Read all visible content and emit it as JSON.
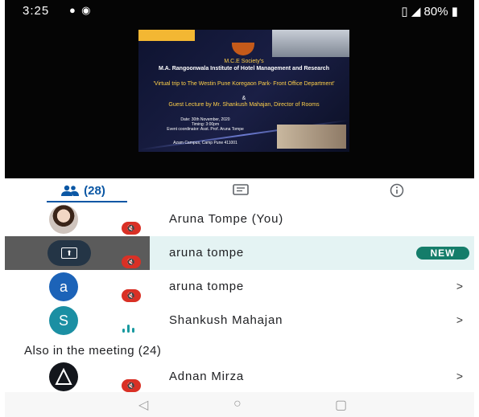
{
  "status_bar": {
    "time": "3:25",
    "battery": "80%"
  },
  "poster": {
    "society": "M.C.E Society's",
    "institute": "M.A. Rangoonwala Institute of Hotel Management and Research",
    "event": "'Virtual trip to The Westin Pune Koregaon Park- Front Office Department'",
    "amp": "&",
    "lecture": "Guest Lecture by Mr. Shankush Mahajan, Director of Rooms",
    "date": "Date: 30th November, 2020",
    "timing": "Timing: 3:00pm",
    "coordinator": "Event coordinator: Asst. Prof. Aruna Tompe",
    "footer": "Azam Campus, Camp Pune 411001"
  },
  "tabs": {
    "people_count": "(28)"
  },
  "participants": [
    {
      "name": "Aruna Tompe (You)"
    },
    {
      "name": "aruna tompe",
      "badge": "NEW"
    },
    {
      "name": "aruna tompe",
      "initial": "a",
      "chevron": ">"
    },
    {
      "name": "Shankush Mahajan",
      "initial": "S",
      "chevron": ">"
    }
  ],
  "section_title": "Also in the meeting (24)",
  "others": [
    {
      "name": "Adnan Mirza",
      "chevron": ">"
    }
  ],
  "colors": {
    "accent": "#0b57a4",
    "mute": "#d93025",
    "badge": "#147d6a",
    "highlight": "#e4f3f3"
  }
}
